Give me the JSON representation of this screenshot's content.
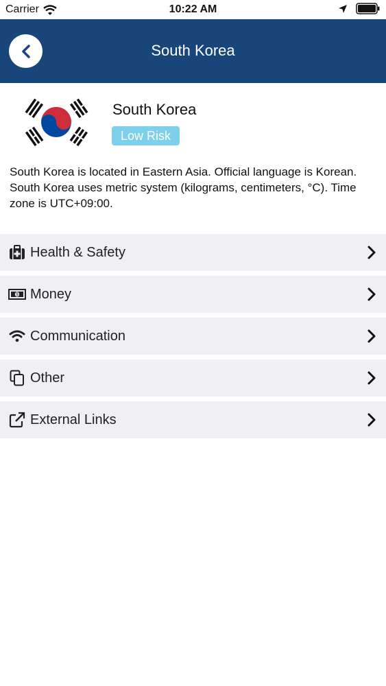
{
  "status_bar": {
    "carrier": "Carrier",
    "time": "10:22 AM"
  },
  "nav": {
    "title": "South Korea",
    "back_icon": "chevron-left-icon"
  },
  "country": {
    "name": "South Korea",
    "risk_label": "Low Risk",
    "description": "South Korea is located in Eastern Asia. Official language is Korean. South Korea uses metric system (kilograms, centimeters, °C). Time zone is UTC+09:00."
  },
  "menu": [
    {
      "label": "Health & Safety",
      "icon": "first-aid-kit-icon"
    },
    {
      "label": "Money",
      "icon": "banknote-icon"
    },
    {
      "label": "Communication",
      "icon": "wifi-icon"
    },
    {
      "label": "Other",
      "icon": "copy-icon"
    },
    {
      "label": "External Links",
      "icon": "external-link-icon"
    }
  ],
  "colors": {
    "navbar": "#18467a",
    "badge": "#7cd0ea",
    "menu_bg": "#efeff4",
    "flag_red": "#cd2e3a",
    "flag_blue": "#0047a0"
  }
}
